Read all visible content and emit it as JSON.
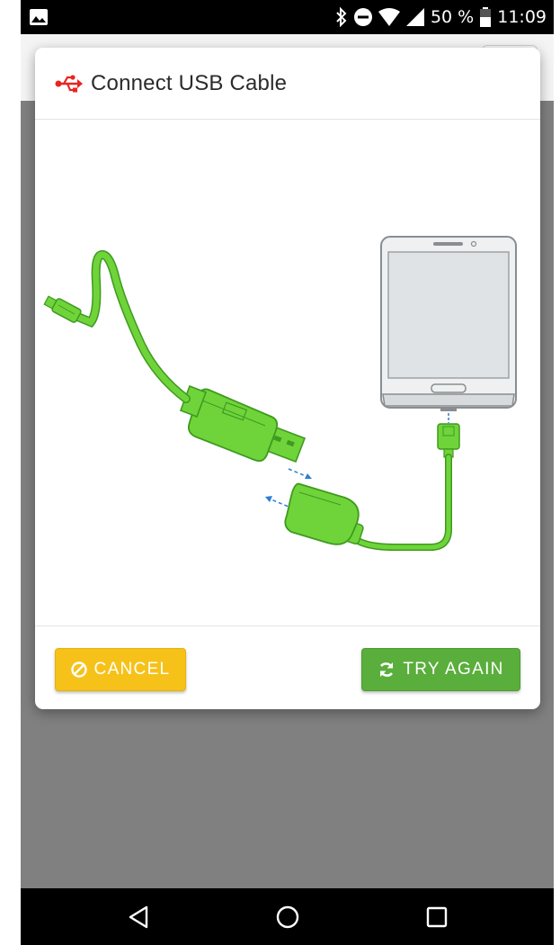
{
  "status_bar": {
    "battery": "50 %",
    "time": "11:09",
    "icons": [
      "image-icon",
      "bluetooth-icon",
      "do-not-disturb-icon",
      "wifi-icon",
      "cell-signal-icon",
      "battery-icon"
    ]
  },
  "dialog": {
    "title": "Connect USB Cable",
    "title_icon": "usb-icon",
    "accent_color": "#e8251f",
    "illustration": [
      "usb-extension-cable",
      "usb-otg-adapter",
      "smartphone"
    ],
    "cancel_label": "CANCEL",
    "cancel_icon": "block-icon",
    "cancel_color": "#f6c21a",
    "try_again_label": "TRY AGAIN",
    "try_again_icon": "refresh-icon",
    "try_again_color": "#5aae3c"
  },
  "nav_bar": {
    "items": [
      "back-icon",
      "home-icon",
      "recents-icon"
    ]
  }
}
